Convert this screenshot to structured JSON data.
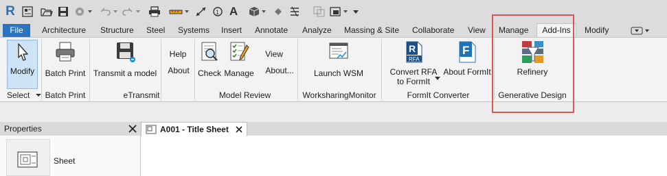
{
  "app": {
    "logo_letter": "R"
  },
  "quick_access": {
    "text_tool_glyph": "A"
  },
  "tabs": {
    "file": "File",
    "items": [
      "Architecture",
      "Structure",
      "Steel",
      "Systems",
      "Insert",
      "Annotate",
      "Analyze",
      "Massing & Site",
      "Collaborate",
      "View",
      "Manage",
      "Add-Ins",
      "Modify"
    ]
  },
  "ribbon": {
    "modify": {
      "label": "Modify",
      "panel": "Select"
    },
    "batch_print": {
      "label": "Batch Print",
      "panel": "Batch Print"
    },
    "transmit": {
      "label": "Transmit a model",
      "panel": "eTransmit"
    },
    "help": {
      "label": "Help"
    },
    "about": {
      "label": "About"
    },
    "check": {
      "label": "Check"
    },
    "manage": {
      "label": "Manage"
    },
    "model_review_panel": "Model Review",
    "view": {
      "label": "View"
    },
    "about_more": {
      "label": "About..."
    },
    "launch_wsm": {
      "label": "Launch WSM",
      "panel": "WorksharingMonitor"
    },
    "convert_rfa": {
      "label_line1": "Convert RFA",
      "label_line2": "to FormIt",
      "icon_text": "RFA"
    },
    "about_formit": {
      "label": "About FormIt"
    },
    "formit_panel": "FormIt Converter",
    "refinery": {
      "label": "Refinery",
      "panel": "Generative Design"
    }
  },
  "properties": {
    "title": "Properties",
    "type_label": "Sheet"
  },
  "document": {
    "tab_title": "A001 - Title Sheet"
  },
  "colors": {
    "file_tab": "#2b74bf",
    "highlight": "#e05353"
  }
}
